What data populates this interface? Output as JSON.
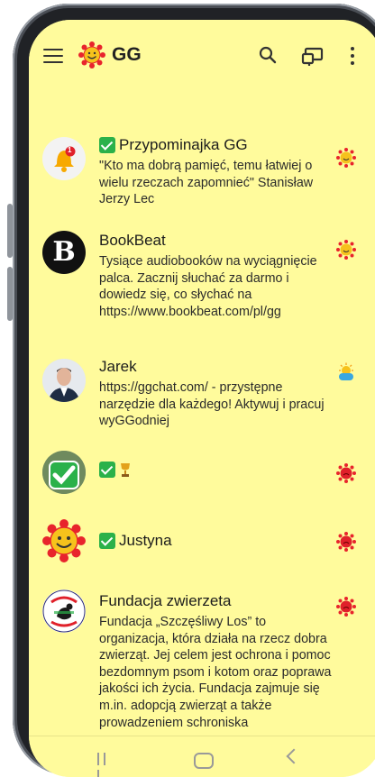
{
  "app": {
    "title": "GG"
  },
  "contacts": [
    {
      "name": "Przypominajka GG",
      "name_prefix_check": true,
      "badge": "1",
      "message": "\"Kto ma dobrą pamięć, temu łatwiej o wielu rzeczach zapomnieć\" Stanisław Jerzy Lec",
      "status": "available"
    },
    {
      "name": "BookBeat",
      "avatar_letter": "B",
      "message": "Tysiące audiobooków na wyciągnięcie palca. Zacznij słuchać za darmo i dowiedz się, co słychać na https://www.bookbeat.com/pl/gg",
      "status": "available"
    },
    {
      "name": "Jarek",
      "message": "https://ggchat.com/ - przystępne narzędzie dla każdego! Aktywuj i pracuj wyGGodniej",
      "status": "away"
    },
    {
      "name": "",
      "name_prefix_check": true,
      "name_suffix_icon": "trophy-icon",
      "message": "",
      "status": "busy"
    },
    {
      "name": "Justyna",
      "name_prefix_check": true,
      "message": "",
      "status": "busy"
    },
    {
      "name": "Fundacja zwierzeta",
      "avatar_text": "FUNDACJA SZCZĘŚLIWY LOS DLA ZWIERZĄT",
      "message": "Fundacja „Szczęśliwy Los” to organizacja, która działa na rzecz dobra zwierząt. Jej celem jest ochrona i pomoc bezdomnym psom i kotom oraz poprawa jakości ich życia. Fundacja zajmuje się m.in. adopcją zwierząt a także prowadzeniem schroniska",
      "status": "busy"
    }
  ],
  "colors": {
    "background": "#fffb9c",
    "available": "#e8a000",
    "busy": "#e0202a",
    "away": "#3aa7e0",
    "check": "#2bb14a"
  }
}
